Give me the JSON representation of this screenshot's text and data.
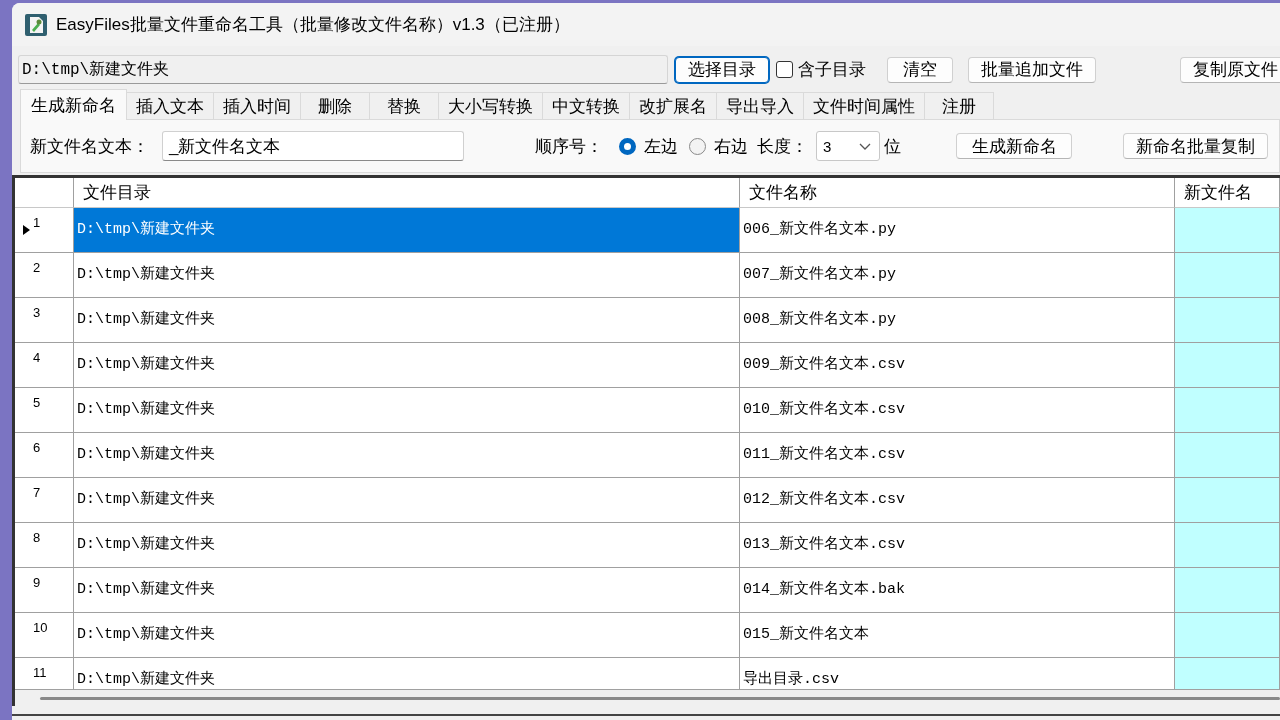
{
  "window": {
    "title": "EasyFiles批量文件重命名工具（批量修改文件名称）v1.3（已注册）"
  },
  "toolbar": {
    "path_field": {
      "value": "D:\\tmp\\新建文件夹"
    },
    "controls": [
      {
        "kind": "button",
        "label": "选择目录",
        "focused": true
      },
      {
        "kind": "checkbox",
        "label": "含子目录",
        "checked": false
      },
      {
        "kind": "button",
        "label": "清空",
        "focused": false
      },
      {
        "kind": "button",
        "label": "批量追加文件",
        "focused": false
      },
      {
        "kind": "button",
        "label": "复制原文件",
        "focused": false
      }
    ]
  },
  "tabs": [
    {
      "label": "生成新命名",
      "selected": true
    },
    {
      "label": "插入文本",
      "selected": false
    },
    {
      "label": "插入时间",
      "selected": false
    },
    {
      "label": "删除",
      "selected": false
    },
    {
      "label": "替换",
      "selected": false
    },
    {
      "label": "大小写转换",
      "selected": false
    },
    {
      "label": "中文转换",
      "selected": false
    },
    {
      "label": "改扩展名",
      "selected": false
    },
    {
      "label": "导出导入",
      "selected": false
    },
    {
      "label": "文件时间属性",
      "selected": false
    },
    {
      "label": "注册",
      "selected": false
    }
  ],
  "panel": {
    "name_label": "新文件名文本：",
    "name_field": {
      "value": "_新文件名文本"
    },
    "sequence_label": "顺序号：",
    "sequence_options": [
      {
        "label": "左边",
        "selected": true
      },
      {
        "label": "右边",
        "selected": false
      }
    ],
    "length_label": "长度：",
    "length_select": {
      "value": "3"
    },
    "length_unit": "位",
    "buttons": [
      "生成新命名",
      "新命名批量复制"
    ]
  },
  "table": {
    "columns": [
      {
        "label": "文件目录"
      },
      {
        "label": "文件名称"
      },
      {
        "label": "新文件名"
      }
    ],
    "rows": [
      {
        "number": "1",
        "directory": "D:\\tmp\\新建文件夹",
        "file_name": "006_新文件名文本.py",
        "selected": true
      },
      {
        "number": "2",
        "directory": "D:\\tmp\\新建文件夹",
        "file_name": "007_新文件名文本.py",
        "selected": false
      },
      {
        "number": "3",
        "directory": "D:\\tmp\\新建文件夹",
        "file_name": "008_新文件名文本.py",
        "selected": false
      },
      {
        "number": "4",
        "directory": "D:\\tmp\\新建文件夹",
        "file_name": "009_新文件名文本.csv",
        "selected": false
      },
      {
        "number": "5",
        "directory": "D:\\tmp\\新建文件夹",
        "file_name": "010_新文件名文本.csv",
        "selected": false
      },
      {
        "number": "6",
        "directory": "D:\\tmp\\新建文件夹",
        "file_name": "011_新文件名文本.csv",
        "selected": false
      },
      {
        "number": "7",
        "directory": "D:\\tmp\\新建文件夹",
        "file_name": "012_新文件名文本.csv",
        "selected": false
      },
      {
        "number": "8",
        "directory": "D:\\tmp\\新建文件夹",
        "file_name": "013_新文件名文本.csv",
        "selected": false
      },
      {
        "number": "9",
        "directory": "D:\\tmp\\新建文件夹",
        "file_name": "014_新文件名文本.bak",
        "selected": false
      },
      {
        "number": "10",
        "directory": "D:\\tmp\\新建文件夹",
        "file_name": "015_新文件名文本",
        "selected": false
      },
      {
        "number": "11",
        "directory": "D:\\tmp\\新建文件夹",
        "file_name": "导出目录.csv",
        "selected": false
      }
    ]
  }
}
